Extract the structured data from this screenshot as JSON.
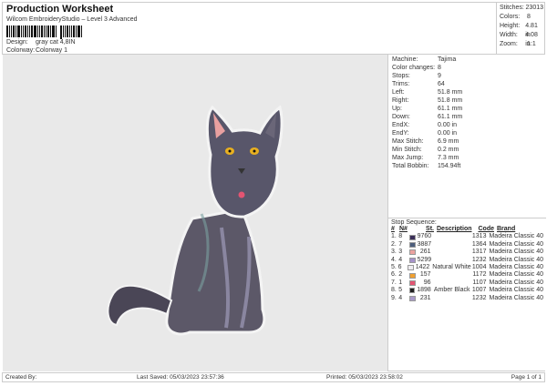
{
  "header": {
    "title": "Production Worksheet",
    "subtitle": "Wilcom EmbroideryStudio – Level 3 Advanced",
    "design_label": "Design:",
    "design": "gray cat 4,8IN",
    "colorway_label": "Colorway:",
    "colorway": "Colorway 1"
  },
  "stats": [
    {
      "label": "Stitches:",
      "value": "23013"
    },
    {
      "label": "Colors:",
      "value": "8"
    },
    {
      "label": "Height:",
      "value": "4.81 in"
    },
    {
      "label": "Width:",
      "value": "4.08 in"
    },
    {
      "label": "Zoom:",
      "value": "1:1"
    }
  ],
  "props": [
    {
      "label": "Machine:",
      "value": "Tajima"
    },
    {
      "label": "Color changes:",
      "value": "8"
    },
    {
      "label": "Stops:",
      "value": "9"
    },
    {
      "label": "Trims:",
      "value": "64"
    },
    {
      "label": "Left:",
      "value": "51.8 mm"
    },
    {
      "label": "Right:",
      "value": "51.8 mm"
    },
    {
      "label": "Up:",
      "value": "61.1 mm"
    },
    {
      "label": "Down:",
      "value": "61.1 mm"
    },
    {
      "label": "EndX:",
      "value": "0.00 in"
    },
    {
      "label": "EndY:",
      "value": "0.00 in"
    },
    {
      "label": "Max Stitch:",
      "value": "6.9 mm"
    },
    {
      "label": "Min Stitch:",
      "value": "0.2 mm"
    },
    {
      "label": "Max Jump:",
      "value": "7.3 mm"
    },
    {
      "label": "Total Bobbin:",
      "value": "154.94ft"
    }
  ],
  "sequence": {
    "title": "Stop Sequence:",
    "headers": [
      "#",
      "N#",
      "St.",
      "Description",
      "Code",
      "Brand"
    ],
    "rows": [
      {
        "n": "1.",
        "num": "8",
        "color": "#3b2f58",
        "st": "9760",
        "desc": "",
        "code": "1313",
        "brand": "Madeira Classic 40"
      },
      {
        "n": "2.",
        "num": "7",
        "color": "#4c5d7c",
        "st": "3887",
        "desc": "",
        "code": "1364",
        "brand": "Madeira Classic 40"
      },
      {
        "n": "3.",
        "num": "3",
        "color": "#eba3a0",
        "st": "261",
        "desc": "",
        "code": "1317",
        "brand": "Madeira Classic 40"
      },
      {
        "n": "4.",
        "num": "4",
        "color": "#a592c9",
        "st": "5299",
        "desc": "",
        "code": "1232",
        "brand": "Madeira Classic 40"
      },
      {
        "n": "5.",
        "num": "6",
        "color": "#eeecf0",
        "st": "1422",
        "desc": "Natural White",
        "code": "1004",
        "brand": "Madeira Classic 40"
      },
      {
        "n": "6.",
        "num": "2",
        "color": "#f0a030",
        "st": "157",
        "desc": "",
        "code": "1172",
        "brand": "Madeira Classic 40"
      },
      {
        "n": "7.",
        "num": "1",
        "color": "#e35472",
        "st": "96",
        "desc": "",
        "code": "1107",
        "brand": "Madeira Classic 40"
      },
      {
        "n": "8.",
        "num": "5",
        "color": "#222222",
        "st": "1898",
        "desc": "Amber Black",
        "code": "1007",
        "brand": "Madeira Classic 40"
      },
      {
        "n": "9.",
        "num": "4",
        "color": "#a99ac9",
        "st": "231",
        "desc": "",
        "code": "1232",
        "brand": "Madeira Classic 40"
      }
    ]
  },
  "footer": {
    "created": "Created By:",
    "saved": "Last Saved: 05/03/2023 23:57:36",
    "printed": "Printed: 05/03/2023 23:58:02",
    "page": "Page 1 of 1"
  }
}
